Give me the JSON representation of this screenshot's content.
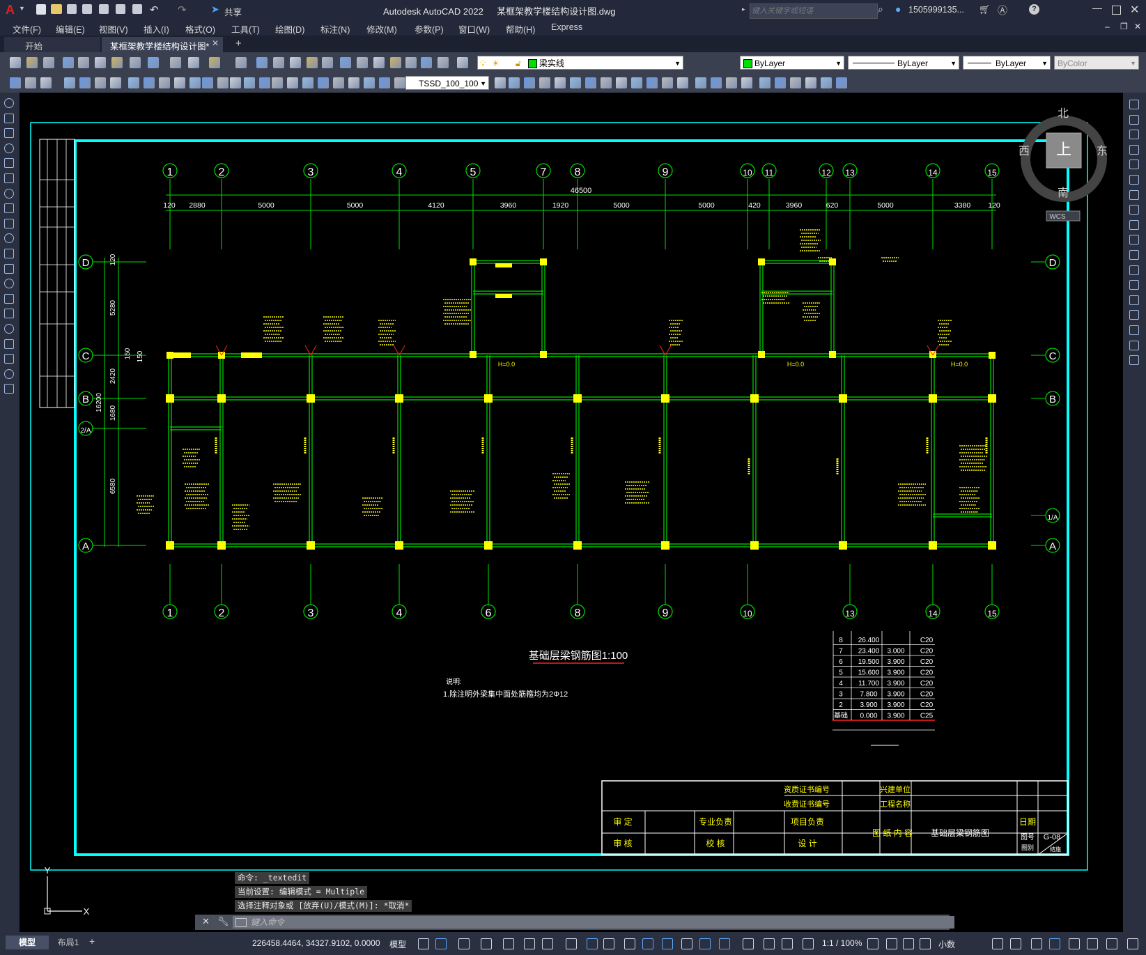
{
  "window": {
    "app_title": "Autodesk AutoCAD 2022",
    "file_title": "某框架教学楼结构设计图.dwg",
    "search_placeholder": "键入关键字或短语",
    "user": "1505999135...",
    "share": "共享"
  },
  "menu": [
    "文件(F)",
    "编辑(E)",
    "视图(V)",
    "插入(I)",
    "格式(O)",
    "工具(T)",
    "绘图(D)",
    "标注(N)",
    "修改(M)",
    "参数(P)",
    "窗口(W)",
    "帮助(H)",
    "Express"
  ],
  "tabs": {
    "start": "开始",
    "drawing": "某框架教学楼结构设计图*"
  },
  "toolbar": {
    "layer": "梁实线",
    "color": "ByLayer",
    "linetype": "ByLayer",
    "lineweight": "ByLayer",
    "plotstyle": "ByColor",
    "textstyle": "TSSD_100_100"
  },
  "viewcube": {
    "north": "北",
    "south": "南",
    "east": "东",
    "west": "西",
    "top": "上",
    "wcs": "WCS"
  },
  "drawing": {
    "top_axes": [
      "1",
      "2",
      "3",
      "4",
      "5",
      "7",
      "8",
      "9",
      "10",
      "11",
      "12",
      "13",
      "14",
      "15"
    ],
    "bottom_axes": [
      "1",
      "2",
      "3",
      "4",
      "6",
      "8",
      "9",
      "10",
      "13",
      "14",
      "15"
    ],
    "total_dim": "46500",
    "dims_top": [
      "120",
      "2880",
      "5000",
      "5000",
      "4120",
      "3960",
      "1920",
      "5000",
      "5000",
      "420",
      "3960",
      "620",
      "5000",
      "3380",
      "120"
    ],
    "row_axes": [
      "D",
      "C",
      "B",
      "1/A",
      "A"
    ],
    "left_row_axes": [
      "D",
      "C",
      "B",
      "2/A",
      "A"
    ],
    "left_dims": [
      "120",
      "5280",
      "2420",
      "1680",
      "6580",
      "16200",
      "150",
      "150"
    ],
    "title": "基础层梁钢筋图1:100",
    "note_title": "说明:",
    "note_text": "1.除注明外梁集中面处筋箍均为2Φ12",
    "level_table": [
      [
        "8",
        "26.400",
        "",
        "C20"
      ],
      [
        "7",
        "23.400",
        "3.000",
        "C20"
      ],
      [
        "6",
        "19.500",
        "3.900",
        "C20"
      ],
      [
        "5",
        "15.600",
        "3.900",
        "C20"
      ],
      [
        "4",
        "11.700",
        "3.900",
        "C20"
      ],
      [
        "3",
        "7.800",
        "3.900",
        "C20"
      ],
      [
        "2",
        "3.900",
        "3.900",
        "C20"
      ],
      [
        "基础",
        "0.000",
        "3.900",
        "C25"
      ]
    ],
    "titleblock": {
      "cert1": "资质证书编号",
      "cert2": "收费证书编号",
      "owner": "兴建单位",
      "project": "工程名称",
      "audit": "审  定",
      "review": "审  核",
      "major": "专业负责",
      "check": "校  核",
      "proj_lead": "项目负责",
      "design": "设  计",
      "content": "图 纸 内 容",
      "sheet_title": "基础层梁钢筋图",
      "date": "日期",
      "drawing_no": "图号",
      "drawing_type": "图别",
      "sheet_no": "G-08",
      "type_val": "结施"
    },
    "h0": "H=0.0"
  },
  "command": {
    "line1": "命令: _textedit",
    "line2": "当前设置: 编辑模式 = Multiple",
    "line3": "选择注释对象或 [放弃(U)/模式(M)]: *取消*",
    "placeholder": "键入命令"
  },
  "status": {
    "model_tab": "模型",
    "layout_tab": "布局1",
    "coords": "226458.4464, 34327.9102, 0.0000",
    "space": "模型",
    "scale": "1:1 / 100%",
    "units": "小数"
  },
  "colors": {
    "green": "#00e000",
    "yellow": "#ffff00",
    "cyan": "#00ffff",
    "red": "#ff2020",
    "white": "#ffffff"
  }
}
